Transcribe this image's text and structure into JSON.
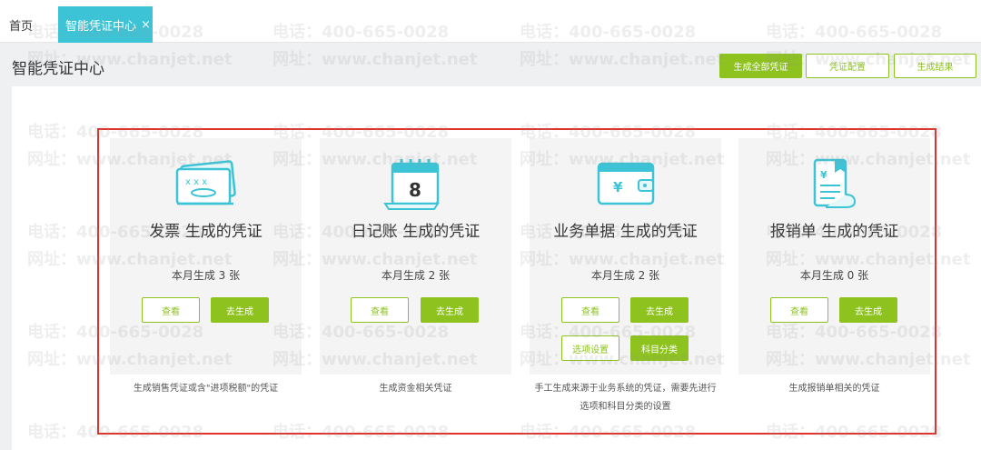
{
  "tabs": {
    "home": "首页",
    "active": "智能凭证中心",
    "close_glyph": "×"
  },
  "page": {
    "title": "智能凭证中心"
  },
  "header_buttons": {
    "generate_all": "生成全部凭证",
    "config": "凭证配置",
    "result": "生成结果"
  },
  "cards": [
    {
      "title": "发票 生成的凭证",
      "stat": "本月生成 3 张",
      "view": "查看",
      "generate": "去生成",
      "desc": "生成销售凭证或含\"进项税额\"的凭证",
      "icon": "invoice-icon"
    },
    {
      "title": "日记账 生成的凭证",
      "stat": "本月生成 2 张",
      "view": "查看",
      "generate": "去生成",
      "desc": "生成资金相关凭证",
      "icon": "journal-calendar-icon"
    },
    {
      "title": "业务单据 生成的凭证",
      "stat": "本月生成  2 张",
      "view": "查看",
      "generate": "去生成",
      "option_settings": "选项设置",
      "subject_category": "科目分类",
      "desc_line1": "手工生成来源于业务系统的凭证，需要先进行",
      "desc_line2": "选项和科目分类的设置",
      "icon": "wallet-icon"
    },
    {
      "title": "报销单 生成的凭证",
      "stat": "本月生成  0 张",
      "view": "查看",
      "generate": "去生成",
      "desc": "生成报销单相关的凭证",
      "icon": "expense-receipt-icon"
    }
  ],
  "watermark": {
    "phone": "电话：400-665-0028",
    "site": "网址：www.chanjet.net"
  },
  "colors": {
    "accent_green": "#8dc21f",
    "tab_cyan": "#3cc4d6",
    "highlight_red": "#e0322b",
    "icon_blue": "#3cc4d6"
  }
}
